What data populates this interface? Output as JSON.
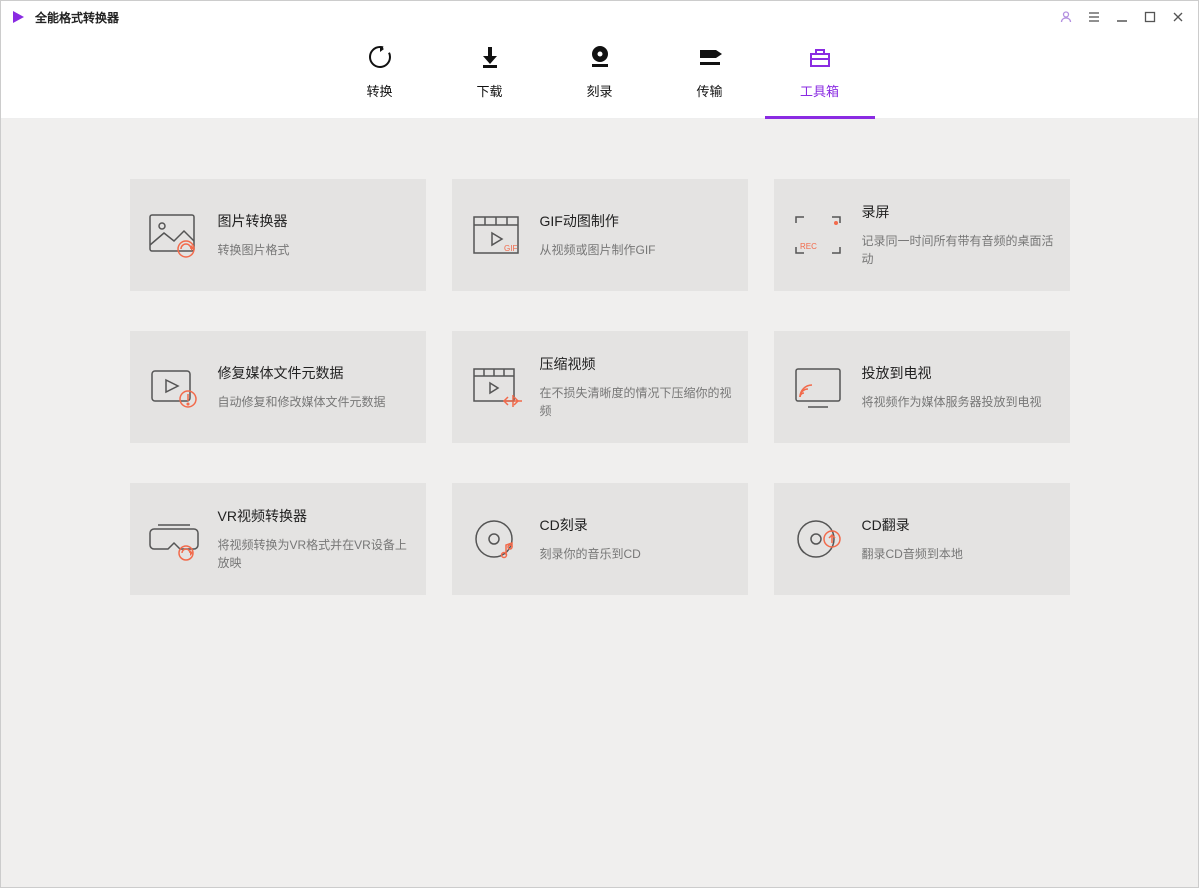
{
  "app": {
    "title": "全能格式转换器"
  },
  "nav": {
    "convert": "转换",
    "download": "下载",
    "burn": "刻录",
    "transfer": "传输",
    "toolbox": "工具箱"
  },
  "tools": [
    {
      "title": "图片转换器",
      "desc": "转换图片格式"
    },
    {
      "title": "GIF动图制作",
      "desc": "从视频或图片制作GIF"
    },
    {
      "title": "录屏",
      "desc": "记录同一时间所有带有音频的桌面活动"
    },
    {
      "title": "修复媒体文件元数据",
      "desc": "自动修复和修改媒体文件元数据"
    },
    {
      "title": "压缩视频",
      "desc": "在不损失清晰度的情况下压缩你的视频"
    },
    {
      "title": "投放到电视",
      "desc": "将视频作为媒体服务器投放到电视"
    },
    {
      "title": "VR视频转换器",
      "desc": "将视频转换为VR格式并在VR设备上放映"
    },
    {
      "title": "CD刻录",
      "desc": "刻录你的音乐到CD"
    },
    {
      "title": "CD翻录",
      "desc": "翻录CD音频到本地"
    }
  ]
}
